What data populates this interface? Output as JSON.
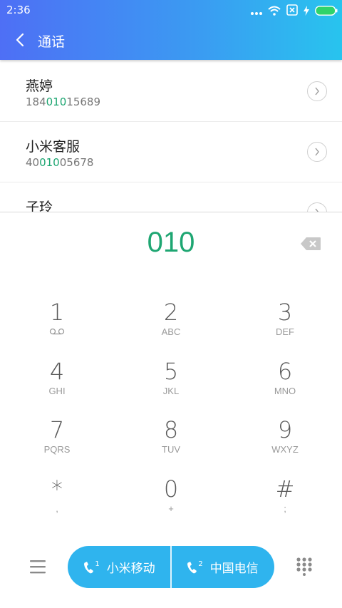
{
  "status": {
    "time": "2:36"
  },
  "header": {
    "title": "通话"
  },
  "contacts": [
    {
      "name": "燕婷",
      "num_pre": "184",
      "num_match": "010",
      "num_post": "15689"
    },
    {
      "name": "小米客服",
      "num_pre": "40",
      "num_match": "010",
      "num_post": "05678"
    },
    {
      "name": "子玲",
      "num_pre": "",
      "num_match": "",
      "num_post": ""
    }
  ],
  "dialer": {
    "input": "010",
    "keys": [
      {
        "digit": "1",
        "letters": ""
      },
      {
        "digit": "2",
        "letters": "ABC"
      },
      {
        "digit": "3",
        "letters": "DEF"
      },
      {
        "digit": "4",
        "letters": "GHI"
      },
      {
        "digit": "5",
        "letters": "JKL"
      },
      {
        "digit": "6",
        "letters": "MNO"
      },
      {
        "digit": "7",
        "letters": "PQRS"
      },
      {
        "digit": "8",
        "letters": "TUV"
      },
      {
        "digit": "9",
        "letters": "WXYZ"
      },
      {
        "digit": "*",
        "letters": ","
      },
      {
        "digit": "0",
        "letters": "+"
      },
      {
        "digit": "#",
        "letters": ";"
      }
    ]
  },
  "call": {
    "sim1_label": "小米移动",
    "sim1_index": "1",
    "sim2_label": "中国电信",
    "sim2_index": "2"
  },
  "colors": {
    "accent": "#1ea672",
    "call_bar": "#2fb4ee"
  }
}
